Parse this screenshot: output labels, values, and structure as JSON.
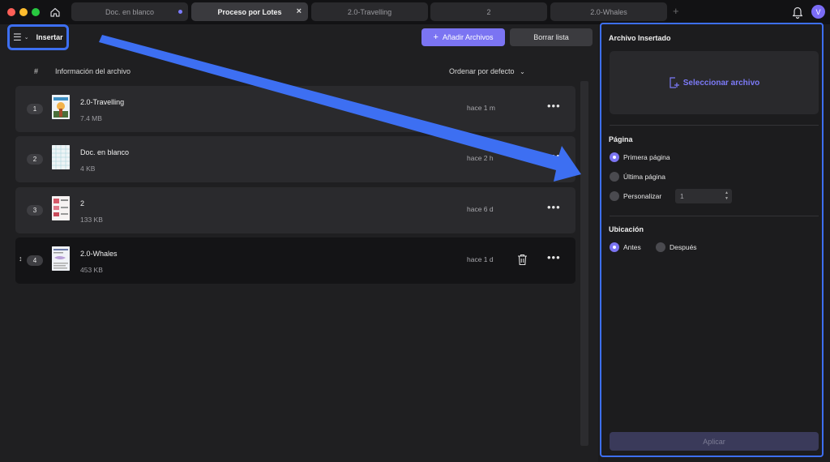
{
  "tabs": [
    {
      "label": "Doc. en blanco"
    },
    {
      "label": "Proceso por Lotes"
    },
    {
      "label": "2.0-Travelling"
    },
    {
      "label": "2"
    },
    {
      "label": "2.0-Whales"
    }
  ],
  "user": {
    "initial": "V"
  },
  "toolbar": {
    "insert_label": "Insertar",
    "add_files_label": "Añadir Archivos",
    "clear_list_label": "Borrar lista"
  },
  "table": {
    "col_number": "#",
    "col_info": "Información del archivo",
    "sort_label": "Ordenar por defecto",
    "rows": [
      {
        "num": "1",
        "name": "2.0-Travelling",
        "size": "7.4 MB",
        "time": "hace 1 m"
      },
      {
        "num": "2",
        "name": "Doc. en blanco",
        "size": "4 KB",
        "time": "hace 2 h"
      },
      {
        "num": "3",
        "name": "2",
        "size": "133 KB",
        "time": "hace 6 d"
      },
      {
        "num": "4",
        "name": "2.0-Whales",
        "size": "453 KB",
        "time": "hace 1 d"
      }
    ]
  },
  "panel": {
    "title": "Archivo Insertado",
    "select_file": "Seleccionar archivo",
    "page_section": "Página",
    "page_options": [
      "Primera página",
      "Última página",
      "Personalizar"
    ],
    "page_selected": "Primera página",
    "custom_value": "1",
    "location_section": "Ubicación",
    "location_options": [
      "Antes",
      "Después"
    ],
    "location_selected": "Antes",
    "apply_label": "Aplicar"
  },
  "colors": {
    "accent": "#7b74f2",
    "highlight_border": "#3d6ff2"
  }
}
